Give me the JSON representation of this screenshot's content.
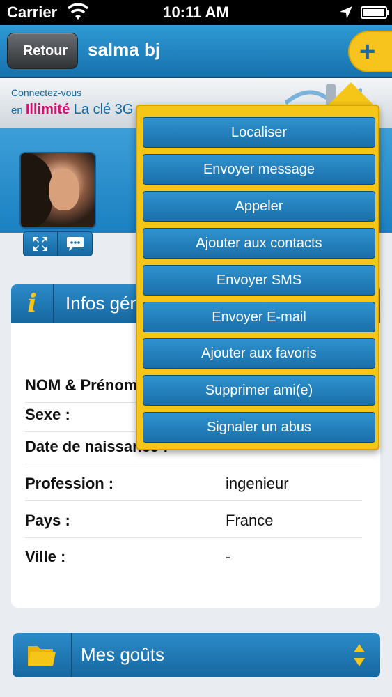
{
  "status_bar": {
    "carrier": "Carrier",
    "time": "10:11 AM"
  },
  "nav": {
    "back_label": "Retour",
    "title": "salma bj",
    "add_symbol": "+"
  },
  "banner": {
    "line1": "Connectez-vous",
    "line2_prefix": "en ",
    "line2_highlight": "Illimité",
    "line2_suffix": " La clé 3G"
  },
  "info": {
    "title": "Infos générales",
    "rows": [
      {
        "label": "NOM & Prénom :",
        "value": ""
      },
      {
        "label": "Sexe :",
        "value": ""
      },
      {
        "label": "Date de naissance :",
        "value": ""
      },
      {
        "label": "Profession :",
        "value": "ingenieur"
      },
      {
        "label": "Pays :",
        "value": "France"
      },
      {
        "label": "Ville :",
        "value": "-"
      }
    ]
  },
  "tastes": {
    "label": "Mes goûts"
  },
  "menu": {
    "items": [
      "Localiser",
      "Envoyer message",
      "Appeler",
      "Ajouter aux contacts",
      "Envoyer SMS",
      "Envoyer E-mail",
      "Ajouter aux favoris",
      "Supprimer ami(e)",
      "Signaler un abus"
    ]
  },
  "colors": {
    "primary_blue": "#1b80c1",
    "accent_yellow": "#f5c518",
    "nav_dark": "#2f3336"
  }
}
